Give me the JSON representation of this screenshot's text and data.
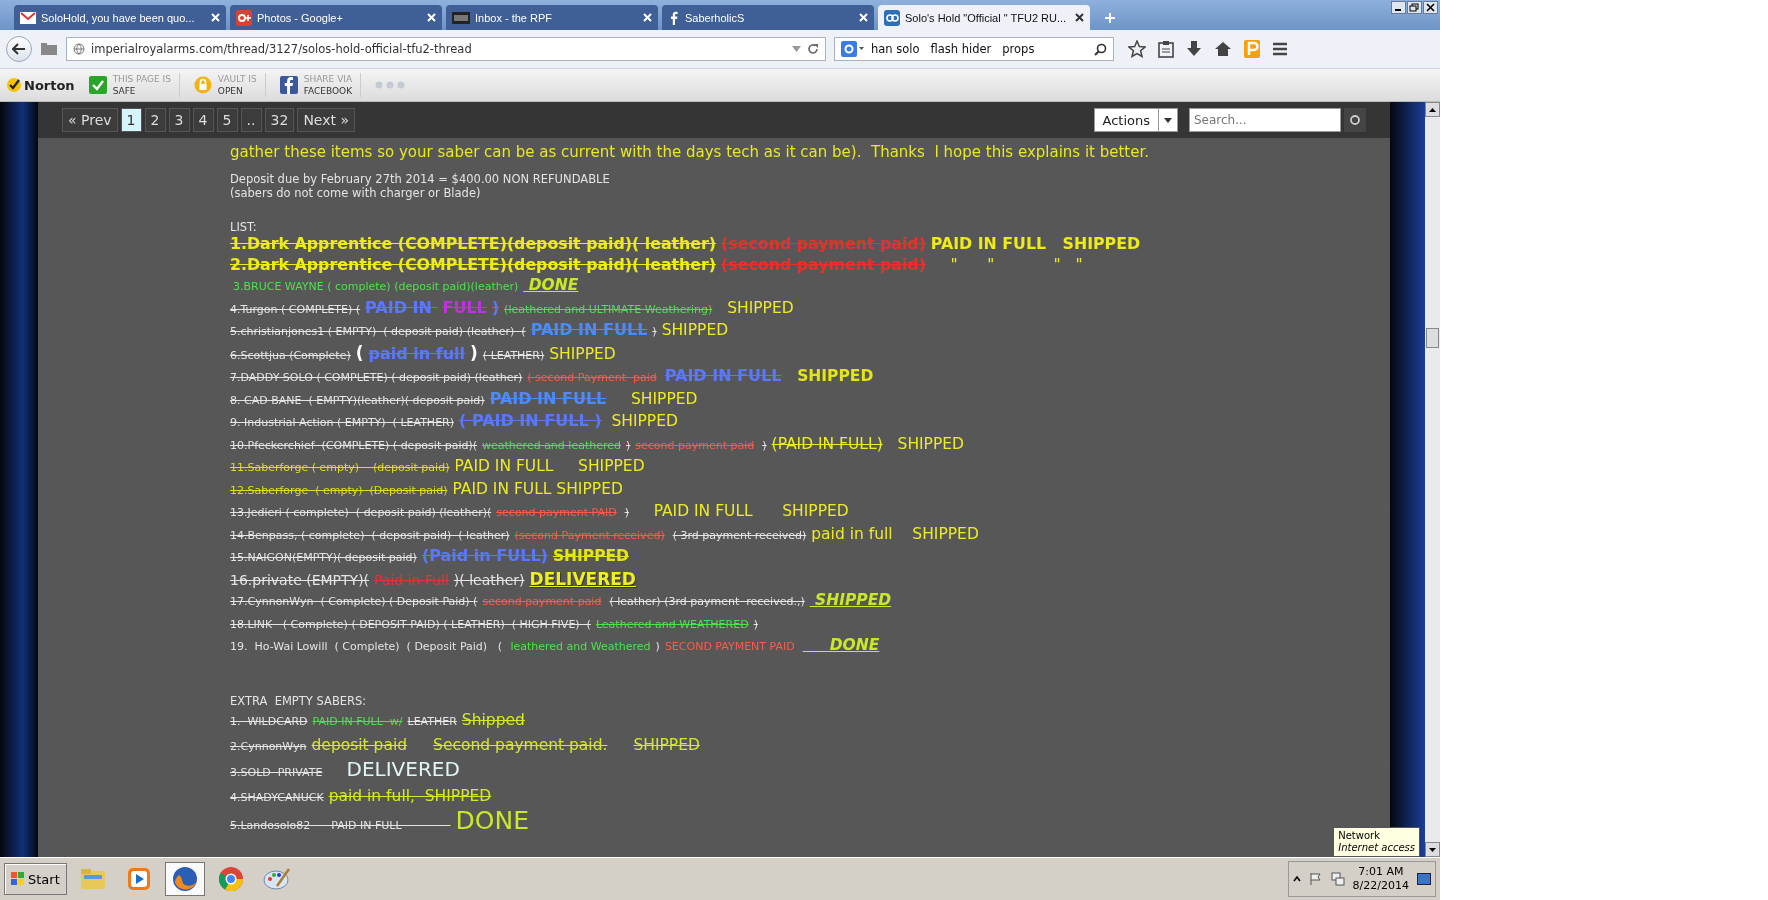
{
  "browser": {
    "tabs": [
      {
        "title": "SoloHold, you have been quo...",
        "kind": "mail",
        "selected": false
      },
      {
        "title": "Photos - Google+",
        "kind": "gplus",
        "selected": false
      },
      {
        "title": "Inbox - the RPF",
        "kind": "rpf",
        "selected": false
      },
      {
        "title": "SaberholicS",
        "kind": "facebook",
        "selected": false
      },
      {
        "title": "Solo's Hold \"Official \" TFU2 RU...",
        "kind": "forum",
        "selected": true
      }
    ],
    "address": "imperialroyalarms.com/thread/3127/solos-hold-official-tfu2-thread",
    "search": "han solo   flash hider   props",
    "norton": {
      "brand": "Norton",
      "items": [
        {
          "kind": "check",
          "top": "THIS PAGE IS",
          "bottom": "SAFE"
        },
        {
          "kind": "vault",
          "top": "VAULT IS",
          "bottom": "OPEN"
        },
        {
          "kind": "facebook",
          "top": "SHARE VIA",
          "bottom": "FACEBOOK"
        }
      ]
    }
  },
  "forum_nav": {
    "pages": [
      {
        "label": "« Prev",
        "selected": false
      },
      {
        "label": "1",
        "selected": true
      },
      {
        "label": "2",
        "selected": false
      },
      {
        "label": "3",
        "selected": false
      },
      {
        "label": "4",
        "selected": false
      },
      {
        "label": "5",
        "selected": false
      },
      {
        "label": "..",
        "selected": false
      },
      {
        "label": "32",
        "selected": false
      },
      {
        "label": "Next »",
        "selected": false
      }
    ],
    "actions": "Actions",
    "search_placeholder": "Search..."
  },
  "post": {
    "intro": "gather these items so your saber can be as current with the days tech as it can be).  Thanks  I hope this explains it better.",
    "deposit": [
      "Deposit due by February 27th 2014 = $400.00 NON REFUNDABLE",
      "(sabers do not come with charger or Blade)"
    ],
    "list_label": "LIST:",
    "entries": [
      {
        "segments": [
          {
            "text": "1.Dark Apprentice (COMPLETE)(deposit paid)( leather)",
            "kind": "head",
            "struck": true
          },
          {
            "text": "(second payment paid)",
            "kind": "head-red",
            "struck": true
          },
          {
            "text": "PAID IN FULL   SHIPPED",
            "kind": "head",
            "struck": false
          }
        ]
      },
      {
        "segments": [
          {
            "text": "2.Dark Apprentice (COMPLETE)(deposit paid)( leather)",
            "kind": "head",
            "struck": true
          },
          {
            "text": "(second payment paid)",
            "kind": "head-red",
            "struck": true
          },
          {
            "text": "    \"      \"            \"   \"",
            "kind": "status",
            "struck": false
          }
        ]
      },
      {
        "segments": [
          {
            "text": "3.BRUCE WAYNE ( complete) (deposit paid)(leather)",
            "kind": "green",
            "struck": false
          },
          {
            "text": " DONE",
            "kind": "lime-bold",
            "struck": false
          }
        ]
      },
      {
        "segments": [
          {
            "text": "4.Turgon ( COMPLETE) (",
            "kind": "small",
            "struck": true
          },
          {
            "text": "PAID IN ",
            "kind": "blue",
            "struck": true
          },
          {
            "text": "FULL",
            "kind": "magenta",
            "struck": true
          },
          {
            "text": ")",
            "kind": "blue",
            "struck": true
          },
          {
            "text": "(leathered and ULTIMATE Weathering)",
            "kind": "green",
            "struck": true
          },
          {
            "text": "  SHIPPED",
            "kind": "status",
            "struck": false
          }
        ]
      },
      {
        "segments": [
          {
            "text": "5.christianjones1 ( EMPTY)  ( deposit paid) (leather)  (",
            "kind": "small",
            "struck": true
          },
          {
            "text": "PAID IN FULL",
            "kind": "lightblue",
            "struck": true
          },
          {
            "text": ")",
            "kind": "small",
            "struck": true
          },
          {
            "text": "SHIPPED",
            "kind": "status",
            "struck": false
          }
        ]
      },
      {
        "segments": [
          {
            "text": "6.Scottjua (Complete)",
            "kind": "small",
            "struck": true
          },
          {
            "text": "(",
            "kind": "bracket",
            "struck": false
          },
          {
            "text": "paid in full",
            "kind": "blue",
            "struck": true
          },
          {
            "text": ")",
            "kind": "bracket",
            "struck": false
          },
          {
            "text": "( LEATHER)",
            "kind": "small",
            "struck": true
          },
          {
            "text": "SHIPPED",
            "kind": "status",
            "struck": false
          }
        ]
      },
      {
        "segments": [
          {
            "text": "7.DADDY SOLO ( COMPLETE) ( deposit paid) (leather)",
            "kind": "small",
            "struck": true
          },
          {
            "text": "( second Payment  paid",
            "kind": "red",
            "struck": true
          },
          {
            "text": "PAID IN FULL",
            "kind": "blue",
            "struck": true
          },
          {
            "text": "  SHIPPED",
            "kind": "status-bold",
            "struck": false
          }
        ]
      },
      {
        "segments": [
          {
            "text": "8. CAD BANE  ( EMPTY)(leather)( deposit paid)",
            "kind": "small",
            "struck": true
          },
          {
            "text": "PAID IN FULL",
            "kind": "lightblue",
            "struck": true
          },
          {
            "text": "    SHIPPED",
            "kind": "status",
            "struck": false
          }
        ]
      },
      {
        "segments": [
          {
            "text": "9. Industrial Action ( EMPTY)  ( LEATHER)",
            "kind": "small",
            "struck": true
          },
          {
            "text": "( PAID IN FULL )",
            "kind": "blue",
            "struck": true
          },
          {
            "text": " SHIPPED",
            "kind": "status",
            "struck": false
          }
        ]
      },
      {
        "segments": [
          {
            "text": "10.Pfeckerchief  (COMPLETE) ( deposit paid)(",
            "kind": "small",
            "struck": true
          },
          {
            "text": "weathered and leathered",
            "kind": "green",
            "struck": true
          },
          {
            "text": ")",
            "kind": "small",
            "struck": true
          },
          {
            "text": "second payment paid",
            "kind": "red",
            "struck": true
          },
          {
            "text": ")",
            "kind": "small",
            "struck": true
          },
          {
            "text": "(PAID IN FULL)",
            "kind": "status",
            "struck": true
          },
          {
            "text": "  SHIPPED",
            "kind": "status",
            "struck": false
          }
        ]
      },
      {
        "segments": [
          {
            "text": "11.Saberforge ( empty)    (deposit paid)",
            "kind": "yellow",
            "struck": true
          },
          {
            "text": "PAID IN FULL     SHIPPED",
            "kind": "status",
            "struck": false
          }
        ]
      },
      {
        "segments": [
          {
            "text": "12.Saberforge  ( empty)  (Deposit paid)",
            "kind": "yellow",
            "struck": true
          },
          {
            "text": "PAID IN FULL SHIPPED",
            "kind": "status",
            "struck": false
          }
        ]
      },
      {
        "segments": [
          {
            "text": "13.Jedieri ( complete)  ( deposit paid) (leather)(",
            "kind": "small",
            "struck": true
          },
          {
            "text": "second payment PAID",
            "kind": "red",
            "struck": true
          },
          {
            "text": ")",
            "kind": "small",
            "struck": true
          },
          {
            "text": "    PAID IN FULL      SHIPPED",
            "kind": "status",
            "struck": false
          }
        ]
      },
      {
        "segments": [
          {
            "text": "14.Benpass, ( complete)  ( deposit paid)  ( leather)",
            "kind": "small",
            "struck": true
          },
          {
            "text": "(second Payment received)",
            "kind": "red",
            "struck": true
          },
          {
            "text": "( 3rd payment received)",
            "kind": "small",
            "struck": true
          },
          {
            "text": "paid in full    SHIPPED",
            "kind": "status",
            "struck": false
          }
        ]
      },
      {
        "segments": [
          {
            "text": "15.NAIGON(EMPTY)( deposit paid)",
            "kind": "small",
            "struck": true
          },
          {
            "text": "(Paid in FULL)",
            "kind": "blue",
            "struck": true
          },
          {
            "text": "SHIPPED",
            "kind": "status-bold",
            "struck": true
          }
        ]
      },
      {
        "segments": [
          {
            "text": "16.private (EMPTY)(",
            "kind": "large",
            "struck": true
          },
          {
            "text": "Paid in Full",
            "kind": "large-red",
            "struck": true
          },
          {
            "text": ")( leather)",
            "kind": "large",
            "struck": true
          },
          {
            "text": "DELIVERED",
            "kind": "delivered",
            "struck": false
          }
        ]
      },
      {
        "segments": [
          {
            "text": "17.CynnonWyn  ( Complete) ( Deposit Paid) (",
            "kind": "small",
            "struck": true
          },
          {
            "text": "second payment paid",
            "kind": "red",
            "struck": true
          },
          {
            "text": "( leather) (3rd payment  received.,)",
            "kind": "small",
            "struck": true
          },
          {
            "text": " SHIPPED",
            "kind": "lime-bold",
            "struck": false
          }
        ]
      },
      {
        "segments": [
          {
            "text": "18.LINK   ( Complete) ( DEPOSIT PAID) ( LEATHER)  ( HIGH FIVE)  (",
            "kind": "small",
            "struck": true
          },
          {
            "text": "Leathered and WEATHERED",
            "kind": "green",
            "struck": true
          },
          {
            "text": ")",
            "kind": "small",
            "struck": true
          }
        ]
      },
      {
        "segments": [
          {
            "text": "19.  Ho-Wai Lowill  ( Complete)  ( Deposit Paid)   ( ",
            "kind": "small",
            "struck": false
          },
          {
            "text": "leathered and Weathered",
            "kind": "green",
            "struck": false
          },
          {
            "text": ")",
            "kind": "small",
            "struck": false
          },
          {
            "text": "SECOND PAYMENT PAID",
            "kind": "red",
            "struck": false
          },
          {
            "text": "     DONE",
            "kind": "lime-bold",
            "struck": false
          }
        ]
      }
    ],
    "extra_label": "EXTRA  EMPTY SABERS:",
    "extra_entries": [
      {
        "segments": [
          {
            "text": "1.  WILDCARD",
            "kind": "small",
            "struck": true
          },
          {
            "text": "PAID IN FULL  w/",
            "kind": "green",
            "struck": true
          },
          {
            "text": "LEATHER",
            "kind": "small",
            "struck": true
          },
          {
            "text": "Shipped",
            "kind": "lime",
            "struck": true
          }
        ]
      },
      {
        "segments": [
          {
            "text": "2.CynnonWyn",
            "kind": "small",
            "struck": true
          },
          {
            "text": "deposit paid",
            "kind": "lime",
            "struck": true
          },
          {
            "text": "Second payment paid.",
            "kind": "lime",
            "struck": true
          },
          {
            "text": "SHIPPED",
            "kind": "lime",
            "struck": true
          }
        ]
      },
      {
        "segments": [
          {
            "text": "3.SOLD  PRIVATE",
            "kind": "small",
            "struck": true
          },
          {
            "text": "   DELIVERED",
            "kind": "pale-large",
            "struck": false
          }
        ]
      },
      {
        "segments": [
          {
            "text": "4.SHADYCANUCK",
            "kind": "small",
            "struck": true
          },
          {
            "text": "paid in full,  SHIPPED",
            "kind": "lime",
            "struck": true
          }
        ]
      },
      {
        "segments": [
          {
            "text": "5.Landosolo82      PAID IN FULL              ",
            "kind": "small",
            "struck": true
          },
          {
            "text": "DONE",
            "kind": "huge-lime",
            "struck": false
          }
        ]
      }
    ]
  },
  "tooltip": {
    "title": "Network",
    "detail": "Internet access"
  },
  "taskbar": {
    "start": "Start",
    "apps": [
      {
        "kind": "folder",
        "active": false
      },
      {
        "kind": "media",
        "active": false
      },
      {
        "kind": "fox",
        "active": true
      },
      {
        "kind": "round",
        "active": false
      },
      {
        "kind": "paint",
        "active": false
      }
    ],
    "time": "7:01 AM",
    "date": "8/22/2014"
  }
}
